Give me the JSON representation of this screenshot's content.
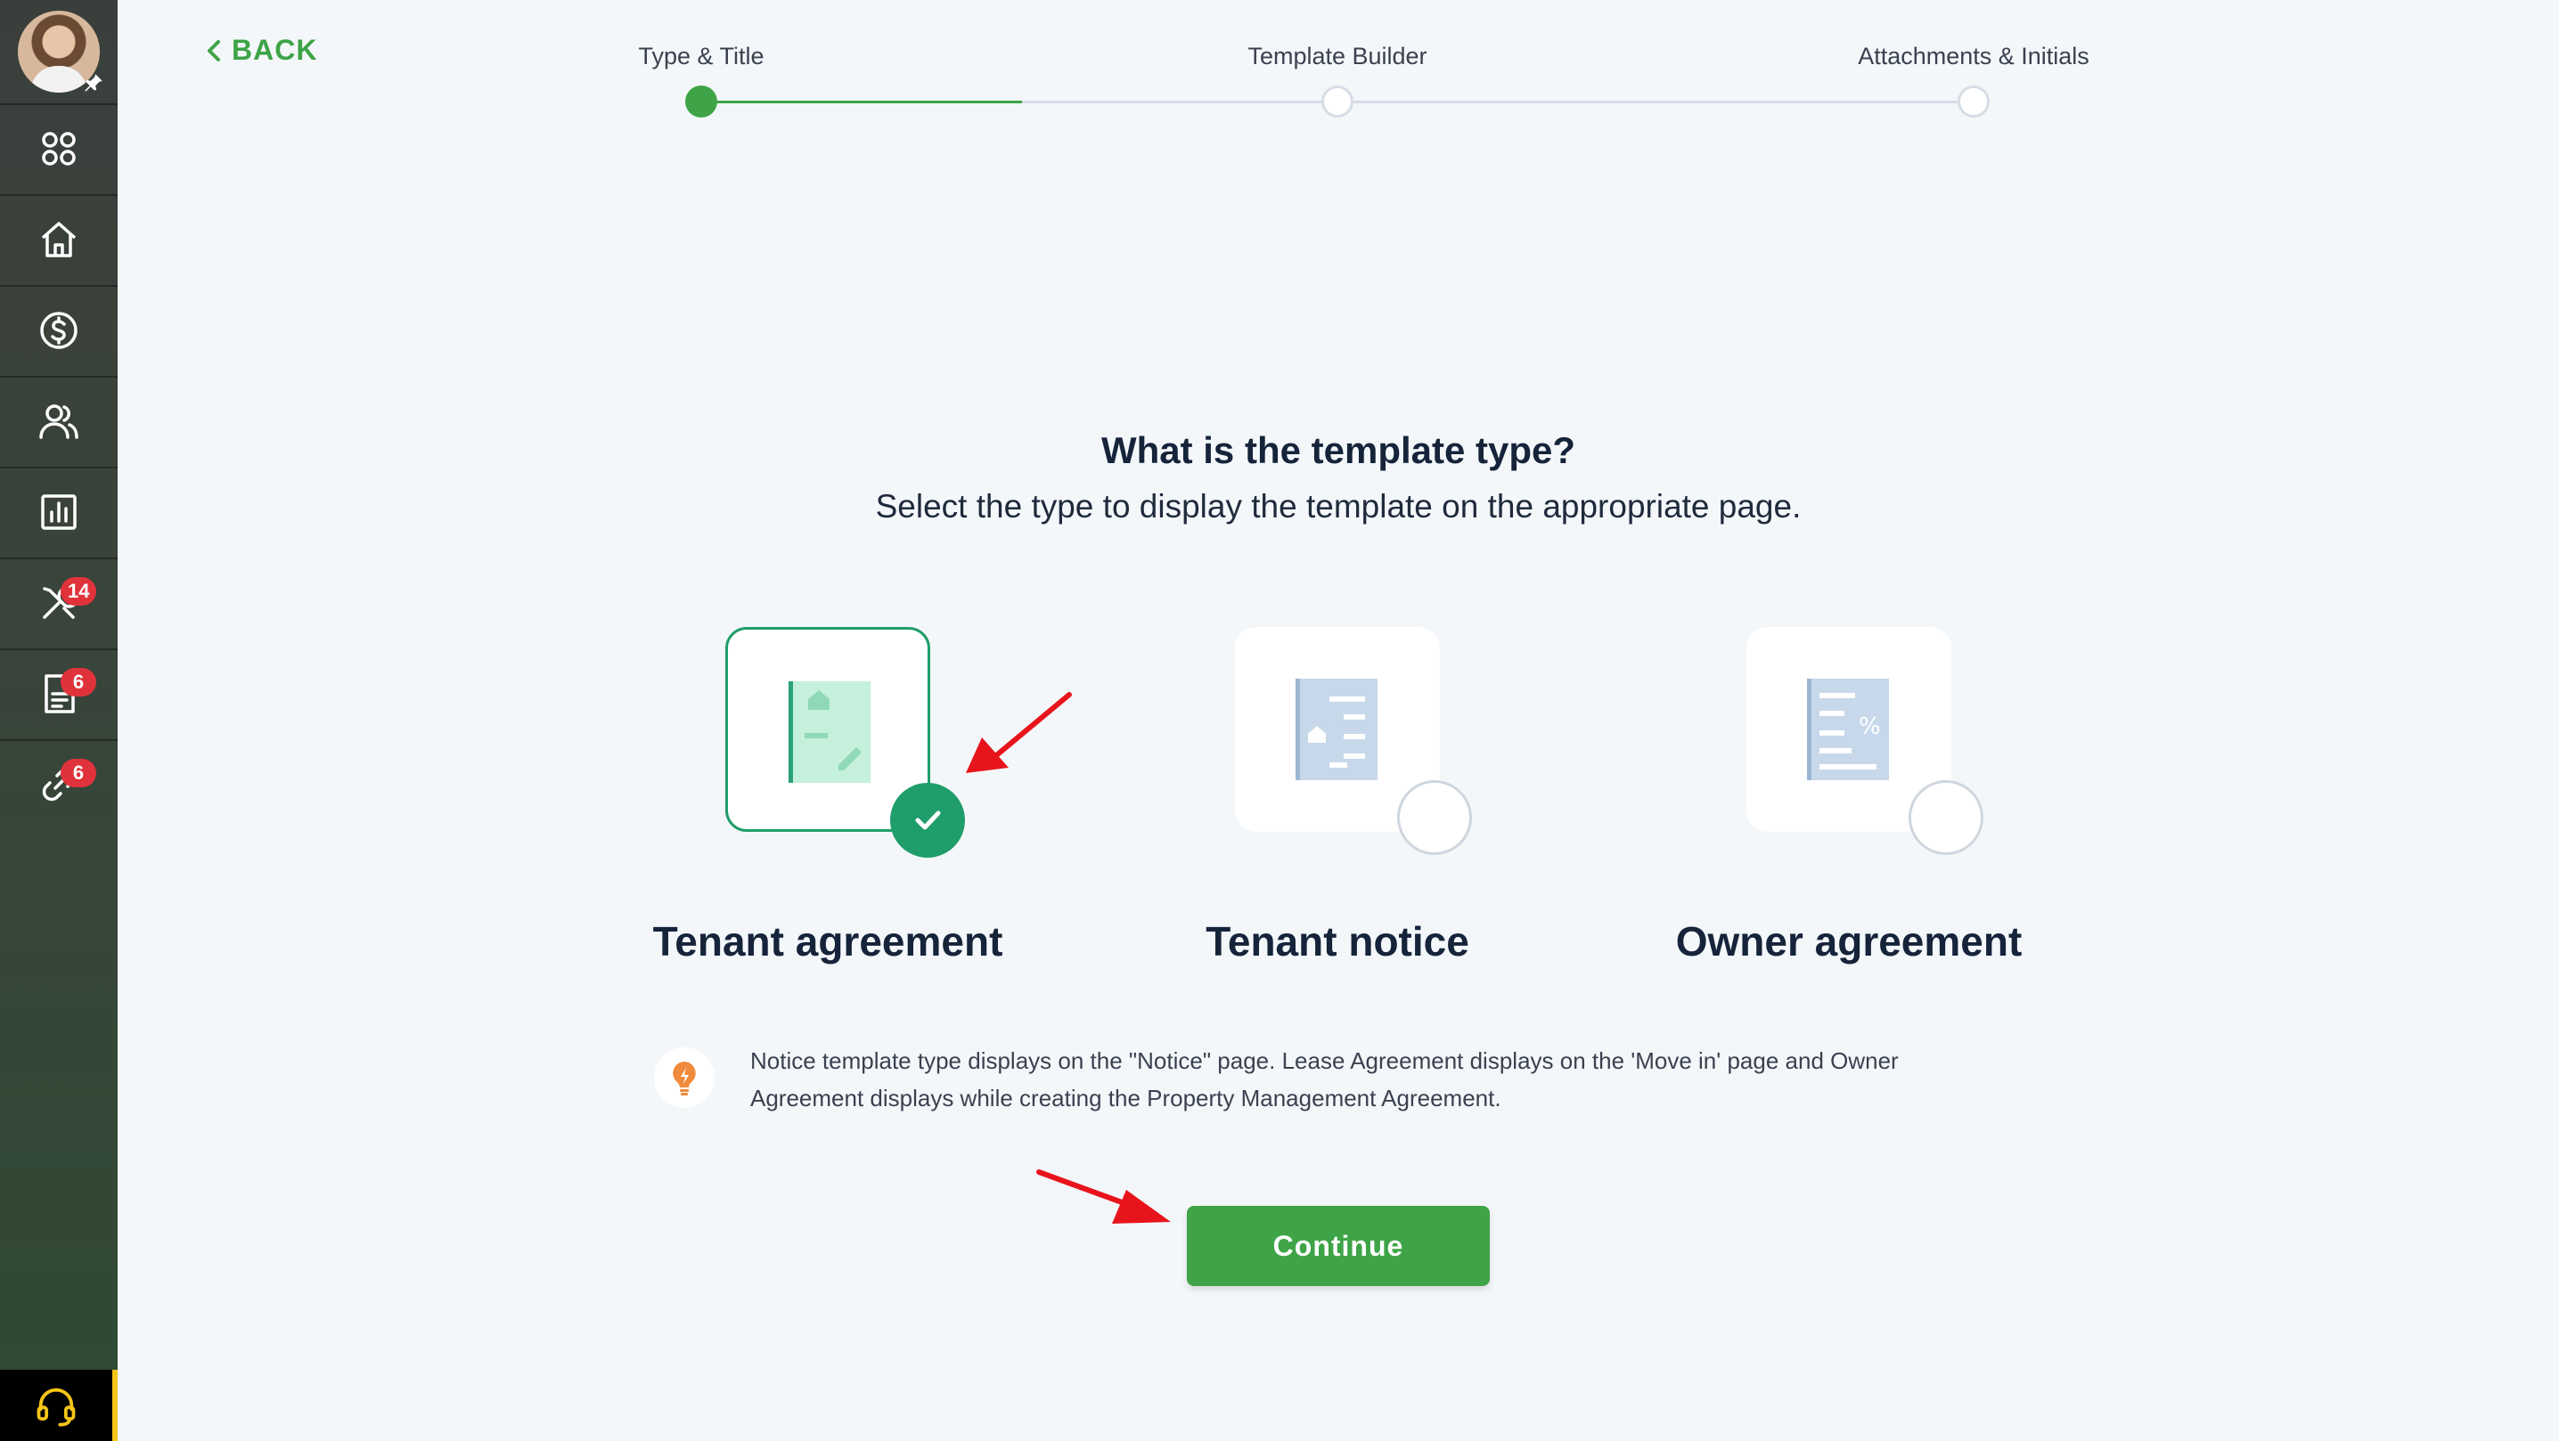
{
  "sidebar": {
    "items": [
      {
        "icon": "apps-grid-icon"
      },
      {
        "icon": "home-icon"
      },
      {
        "icon": "dollar-icon"
      },
      {
        "icon": "users-icon"
      },
      {
        "icon": "reports-icon"
      },
      {
        "icon": "tools-icon",
        "badge": "14"
      },
      {
        "icon": "document-icon",
        "badge": "6"
      },
      {
        "icon": "link-icon",
        "badge": "6"
      }
    ],
    "support_icon": "headset-icon"
  },
  "header": {
    "back_label": "BACK"
  },
  "stepper": {
    "steps": [
      {
        "label": "Type & Title",
        "state": "active"
      },
      {
        "label": "Template Builder",
        "state": "todo"
      },
      {
        "label": "Attachments & Initials",
        "state": "todo"
      }
    ]
  },
  "main": {
    "title": "What is the template type?",
    "subtitle": "Select the type to display the template on the appropriate page.",
    "options": [
      {
        "label": "Tenant agreement",
        "selected": true,
        "icon": "tenant-agreement-doc-icon"
      },
      {
        "label": "Tenant notice",
        "selected": false,
        "icon": "tenant-notice-doc-icon"
      },
      {
        "label": "Owner agreement",
        "selected": false,
        "icon": "owner-agreement-doc-icon"
      }
    ],
    "info_line1": "Notice template type displays on the \"Notice\" page. Lease Agreement displays on the 'Move in' page and Owner",
    "info_line2": "Agreement displays while creating the Property Management Agreement.",
    "continue_label": "Continue"
  },
  "colors": {
    "accent_green": "#3ea447",
    "selected_teal": "#1f9d6a",
    "badge_red": "#e0323a",
    "annotation_red": "#e8141c"
  }
}
